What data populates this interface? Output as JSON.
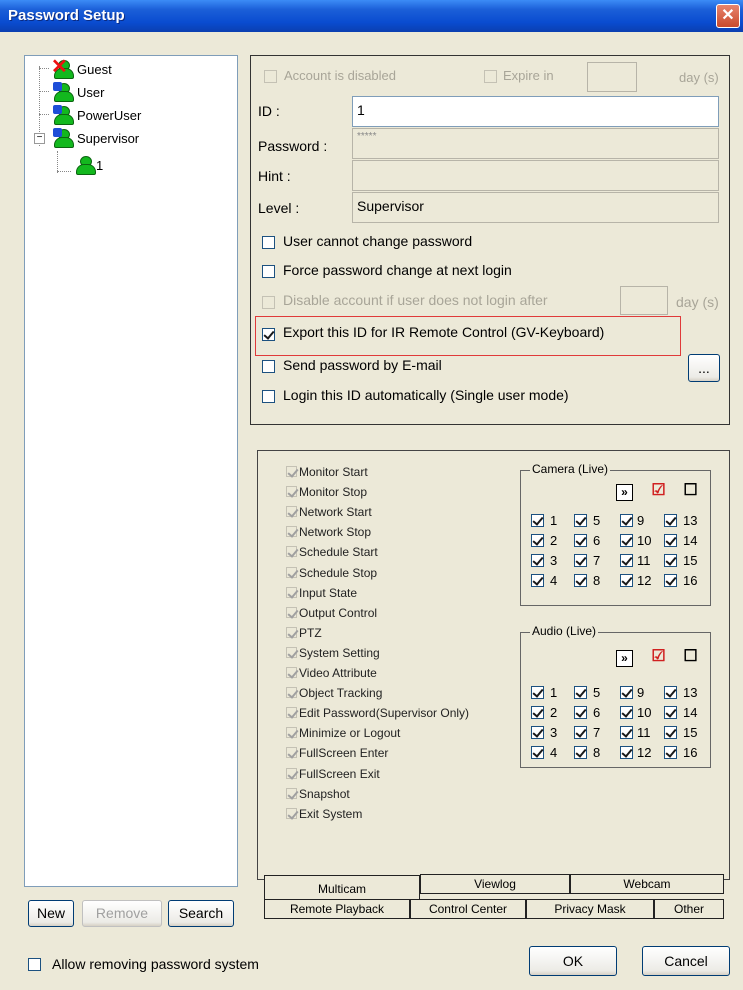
{
  "window": {
    "title": "Password Setup",
    "close_symbol": "✕"
  },
  "tree": {
    "items": [
      {
        "label": "Guest",
        "icon": "guest-disabled-user-icon"
      },
      {
        "label": "User",
        "icon": "user-icon"
      },
      {
        "label": "PowerUser",
        "icon": "poweruser-icon"
      },
      {
        "label": "Supervisor",
        "icon": "supervisor-icon",
        "expander": "−"
      },
      {
        "label": "1",
        "icon": "user-account-icon"
      }
    ]
  },
  "account": {
    "disabled_label": "Account is disabled",
    "expire_label": "Expire in",
    "expire_unit": "day (s)",
    "id_label": "ID :",
    "id_value": "1",
    "password_label": "Password :",
    "password_value": "*****",
    "hint_label": "Hint :",
    "hint_value": "",
    "level_label": "Level :",
    "level_value": "Supervisor",
    "options": [
      {
        "label": "User cannot change password",
        "checked": false,
        "enabled": true
      },
      {
        "label": "Force password change at next login",
        "checked": false,
        "enabled": true
      },
      {
        "label": "Disable account if user does not login after",
        "checked": false,
        "enabled": false,
        "unit": "day (s)"
      },
      {
        "label": "Export this ID for IR Remote Control (GV-Keyboard)",
        "checked": true,
        "enabled": true,
        "highlighted": true
      },
      {
        "label": "Send password by E-mail",
        "checked": false,
        "enabled": true,
        "button": "..."
      },
      {
        "label": "Login this ID automatically (Single user mode)",
        "checked": false,
        "enabled": true
      }
    ]
  },
  "permissions": [
    "Monitor Start",
    "Monitor Stop",
    "Network Start",
    "Network Stop",
    "Schedule Start",
    "Schedule Stop",
    "Input State",
    "Output Control",
    "PTZ",
    "System Setting",
    "Video Attribute",
    "Object Tracking",
    "Edit Password(Supervisor Only)",
    "Minimize or Logout",
    "FullScreen Enter",
    "FullScreen Exit",
    "Snapshot",
    "Exit System"
  ],
  "camera_live": {
    "title": "Camera (Live)",
    "tools": [
      "»",
      "☑",
      "☐"
    ],
    "channels": [
      "1",
      "2",
      "3",
      "4",
      "5",
      "6",
      "7",
      "8",
      "9",
      "10",
      "11",
      "12",
      "13",
      "14",
      "15",
      "16"
    ]
  },
  "audio_live": {
    "title": "Audio (Live)",
    "tools": [
      "»",
      "☑",
      "☐"
    ],
    "channels": [
      "1",
      "2",
      "3",
      "4",
      "5",
      "6",
      "7",
      "8",
      "9",
      "10",
      "11",
      "12",
      "13",
      "14",
      "15",
      "16"
    ]
  },
  "tabs": {
    "row1": [
      "Multicam",
      "Viewlog",
      "Webcam"
    ],
    "row2": [
      "Remote Playback",
      "Control Center",
      "Privacy Mask",
      "Other"
    ]
  },
  "buttons": {
    "new": "New",
    "remove": "Remove",
    "search": "Search",
    "ok": "OK",
    "cancel": "Cancel"
  },
  "footer": {
    "allow_remove_label": "Allow removing password system"
  }
}
